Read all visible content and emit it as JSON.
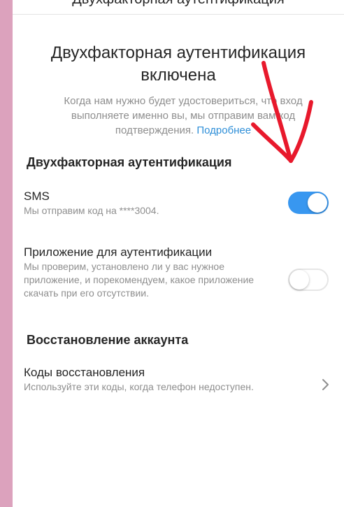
{
  "header": {
    "title": "Двухфакторная аутентификация"
  },
  "hero": {
    "title": "Двухфакторная аутентификация включена",
    "description": "Когда нам нужно будет удостовериться, что вход выполняете именно вы, мы отправим вам код подтверждения.",
    "link": "Подробнее"
  },
  "two_factor": {
    "section_title": "Двухфакторная аутентификация",
    "sms": {
      "title": "SMS",
      "description": "Мы отправим код на ****3004.",
      "enabled": true
    },
    "auth_app": {
      "title": "Приложение для аутентификации",
      "description": "Мы проверим, установлено ли у вас нужное приложение, и порекомендуем, какое приложение скачать при его отсутствии.",
      "enabled": false
    }
  },
  "recovery": {
    "section_title": "Восстановление аккаунта",
    "codes": {
      "title": "Коды восстановления",
      "description": "Используйте эти коды, когда телефон недоступен."
    }
  },
  "icons": {
    "chevron": "chevron-right-icon"
  },
  "colors": {
    "background": "#dca2bd",
    "accent": "#3897f0",
    "link": "#2f8fd8",
    "annotation": "#e8192c"
  }
}
